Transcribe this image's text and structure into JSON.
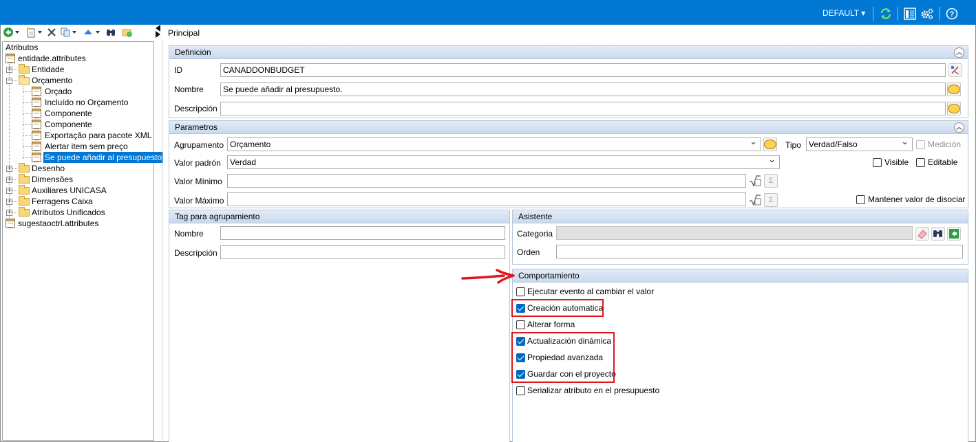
{
  "topbar": {
    "profile": "DEFAULT",
    "profile_caret": "▾",
    "accent": "#0078d4"
  },
  "tree": {
    "root_label": "Atributos",
    "items": [
      {
        "label": "entidade.attributes"
      },
      {
        "label": "Entidade"
      },
      {
        "label": "Orçamento"
      },
      {
        "label": "Orçado"
      },
      {
        "label": "Incluído no Orçamento"
      },
      {
        "label": "Componente"
      },
      {
        "label": "Componente"
      },
      {
        "label": "Exportação para pacote XML"
      },
      {
        "label": "Alertar item sem preço"
      },
      {
        "label": "Se puede añadir al presupuesto"
      },
      {
        "label": "Desenho"
      },
      {
        "label": "Dimensões"
      },
      {
        "label": "Auxiliares UNICASA"
      },
      {
        "label": "Ferragens Caixa"
      },
      {
        "label": "Atributos Unificados"
      },
      {
        "label": "sugestaoctrl.attributes"
      }
    ]
  },
  "main": {
    "tab": "Principal",
    "definicion": {
      "title": "Definición",
      "id_label": "ID",
      "id_value": "CANADDONBUDGET",
      "nombre_label": "Nombre",
      "nombre_value": "Se puede añadir al presupuesto.",
      "descripcion_label": "Descripción",
      "descripcion_value": ""
    },
    "parametros": {
      "title": "Parametros",
      "agrupamento_label": "Agrupamento",
      "agrupamento_value": "Orçamento",
      "tipo_label": "Tipo",
      "tipo_value": "Verdad/Falso",
      "medicion_label": "Medición",
      "valor_padron_label": "Valor padrón",
      "valor_padron_value": "Verdad",
      "visible_label": "Visible",
      "editable_label": "Editable",
      "valor_minimo_label": "Valor Mínimo",
      "valor_maximo_label": "Valor Máximo",
      "mantener_label": "Mantener valor de disociar",
      "sigma": "Σ"
    },
    "tag": {
      "title": "Tag para agrupamiento",
      "nombre_label": "Nombre",
      "descripcion_label": "Descripción"
    },
    "asistente": {
      "title": "Asistente",
      "categoria_label": "Categoria",
      "orden_label": "Orden"
    },
    "comportamiento": {
      "title": "Comportamiento",
      "options": [
        {
          "label": "Ejecutar evento al cambiar el valor",
          "checked": false
        },
        {
          "label": "Creación automatica",
          "checked": true
        },
        {
          "label": "Alterar forma",
          "checked": false
        },
        {
          "label": "Actualización dinámica",
          "checked": true
        },
        {
          "label": "Propiedad avanzada",
          "checked": true
        },
        {
          "label": "Guardar con el proyecto",
          "checked": true
        },
        {
          "label": "Serializar atributo en el presupuesto",
          "checked": false
        }
      ]
    }
  },
  "annotation_color": "#e0161b"
}
